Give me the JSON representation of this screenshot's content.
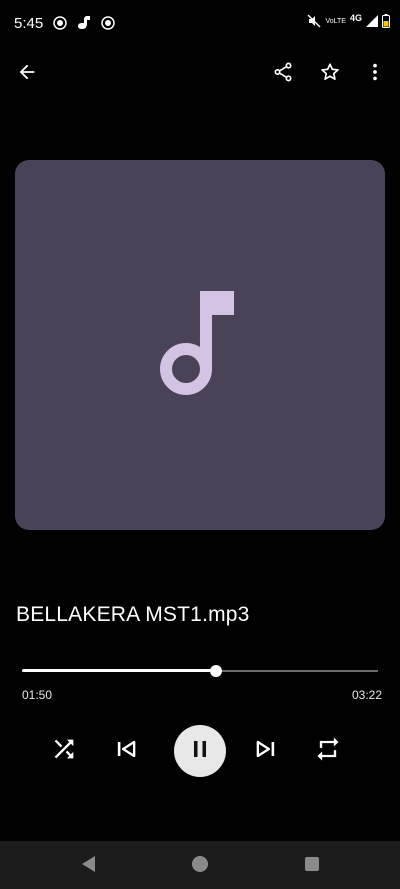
{
  "status_bar": {
    "time": "5:45",
    "volte_top": "Vo",
    "volte_bottom": "LTE",
    "network": "4G"
  },
  "app_bar": {
    "back_icon": "arrow-back-icon",
    "share_icon": "share-icon",
    "favorite_icon": "star-outline-icon",
    "more_icon": "more-vert-icon"
  },
  "album_art": {
    "background_color": "#4a4257",
    "icon": "music-note-icon",
    "icon_color": "#d4c4e4"
  },
  "track": {
    "title": "BELLAKERA MST1.mp3"
  },
  "playback": {
    "elapsed": "01:50",
    "total": "03:22",
    "progress": 0.545
  },
  "controls": {
    "shuffle_icon": "shuffle-icon",
    "previous_icon": "skip-previous-icon",
    "pause_icon": "pause-icon",
    "next_icon": "skip-next-icon",
    "repeat_icon": "repeat-icon"
  },
  "nav_bar": {
    "back_icon": "nav-back-icon",
    "home_icon": "nav-home-icon",
    "recents_icon": "nav-recents-icon"
  }
}
